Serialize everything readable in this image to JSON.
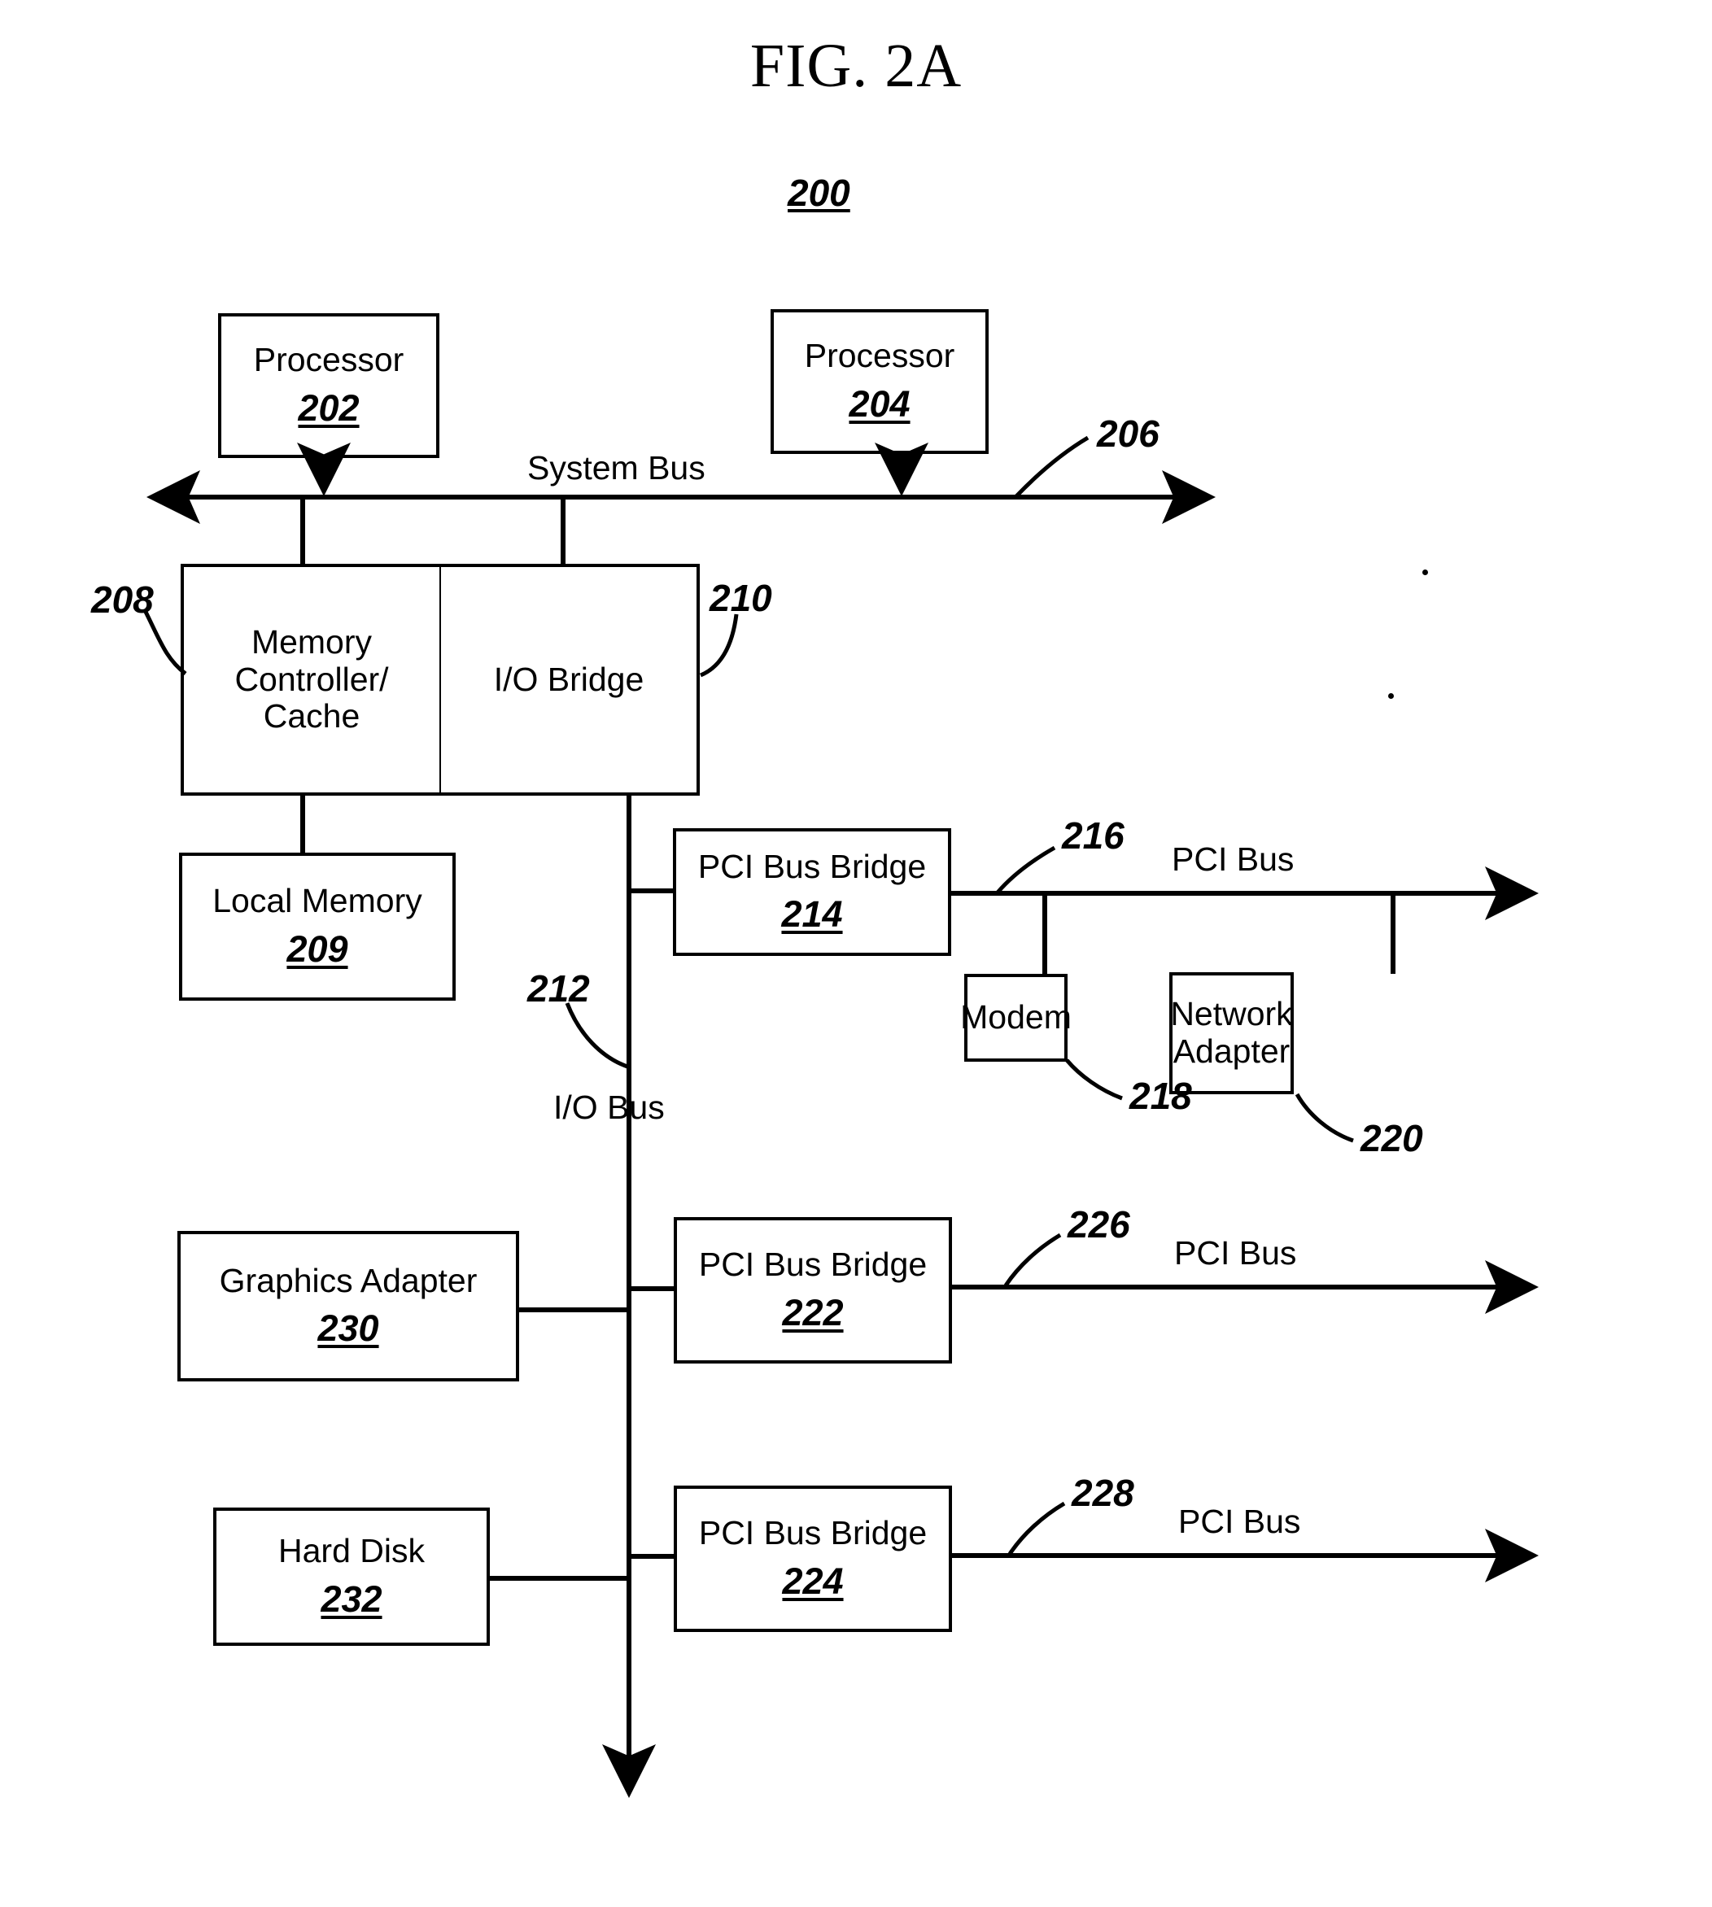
{
  "figure": {
    "title": "FIG. 2A",
    "system_ref": "200"
  },
  "nodes": [
    {
      "id": "processor_202",
      "label": "Processor",
      "ref": "202"
    },
    {
      "id": "processor_204",
      "label": "Processor",
      "ref": "204"
    },
    {
      "id": "memory_controller",
      "label": "Memory\nController/\nCache",
      "ref": ""
    },
    {
      "id": "io_bridge",
      "label": "I/O Bridge",
      "ref": ""
    },
    {
      "id": "local_memory",
      "label": "Local Memory",
      "ref": "209"
    },
    {
      "id": "pci_bus_bridge_214",
      "label": "PCI Bus Bridge",
      "ref": "214"
    },
    {
      "id": "modem",
      "label": "Modem",
      "ref": ""
    },
    {
      "id": "network_adapter",
      "label": "Network\nAdapter",
      "ref": ""
    },
    {
      "id": "graphics_adapter",
      "label": "Graphics Adapter",
      "ref": "230"
    },
    {
      "id": "pci_bus_bridge_222",
      "label": "PCI Bus Bridge",
      "ref": "222"
    },
    {
      "id": "hard_disk",
      "label": "Hard Disk",
      "ref": "232"
    },
    {
      "id": "pci_bus_bridge_224",
      "label": "PCI Bus Bridge",
      "ref": "224"
    }
  ],
  "bus_labels": {
    "system_bus": "System Bus",
    "io_bus": "I/O Bus",
    "pci_bus_216": "PCI Bus",
    "pci_bus_226": "PCI Bus",
    "pci_bus_228": "PCI Bus"
  },
  "reference_numerals": {
    "system_bus_206": "206",
    "memory_controller_208": "208",
    "io_bridge_210": "210",
    "io_bus_212": "212",
    "pci_bus_216": "216",
    "modem_218": "218",
    "network_adapter_220": "220",
    "pci_bus_226": "226",
    "pci_bus_228": "228"
  },
  "colors": {
    "ink": "#000000",
    "paper": "#ffffff"
  }
}
